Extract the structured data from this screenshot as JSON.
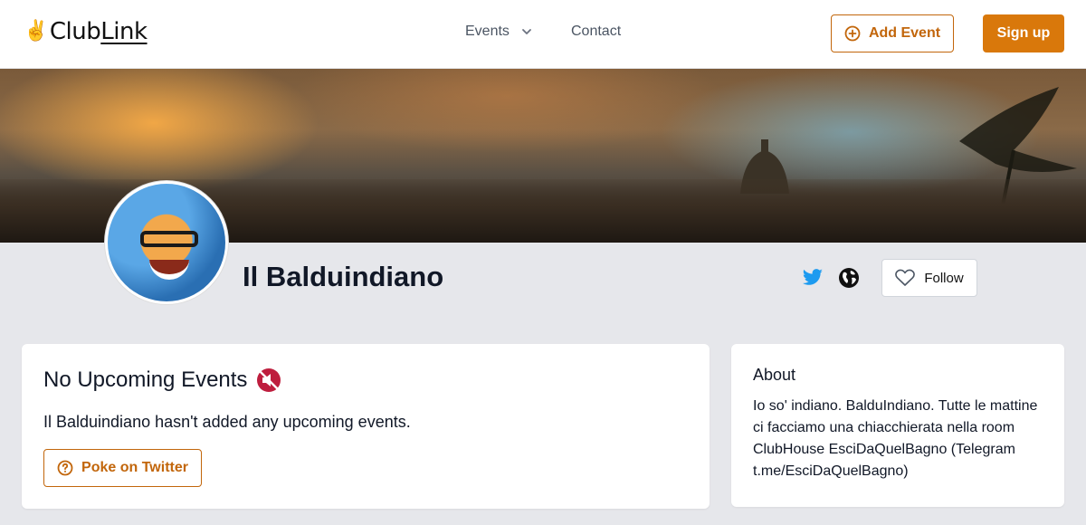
{
  "header": {
    "logo_hand": "✌️",
    "logo_club": "Club",
    "logo_link": "Link",
    "nav": {
      "events_label": "Events",
      "contact_label": "Contact"
    },
    "add_event_label": "Add Event",
    "signup_label": "Sign up"
  },
  "profile": {
    "name": "Il Balduindiano",
    "follow_label": "Follow"
  },
  "events_card": {
    "title": "No Upcoming Events",
    "description": "Il Balduindiano hasn't added any upcoming events.",
    "poke_label": "Poke on Twitter"
  },
  "about_card": {
    "title": "About",
    "text": "Io so' indiano. BalduIndiano. Tutte le mattine ci facciamo una chiacchierata nella room ClubHouse EsciDaQuelBagno (Telegram t.me/EsciDaQuelBagno)"
  },
  "colors": {
    "accent": "#d9780b",
    "accent_outline": "#c2660b",
    "twitter": "#1d9bf0",
    "page_bg": "#e6e7eb"
  },
  "icons": [
    "chevron-down-icon",
    "plus-circle-icon",
    "twitter-icon",
    "globe-icon",
    "heart-icon",
    "muted-speaker-icon",
    "question-circle-icon"
  ]
}
